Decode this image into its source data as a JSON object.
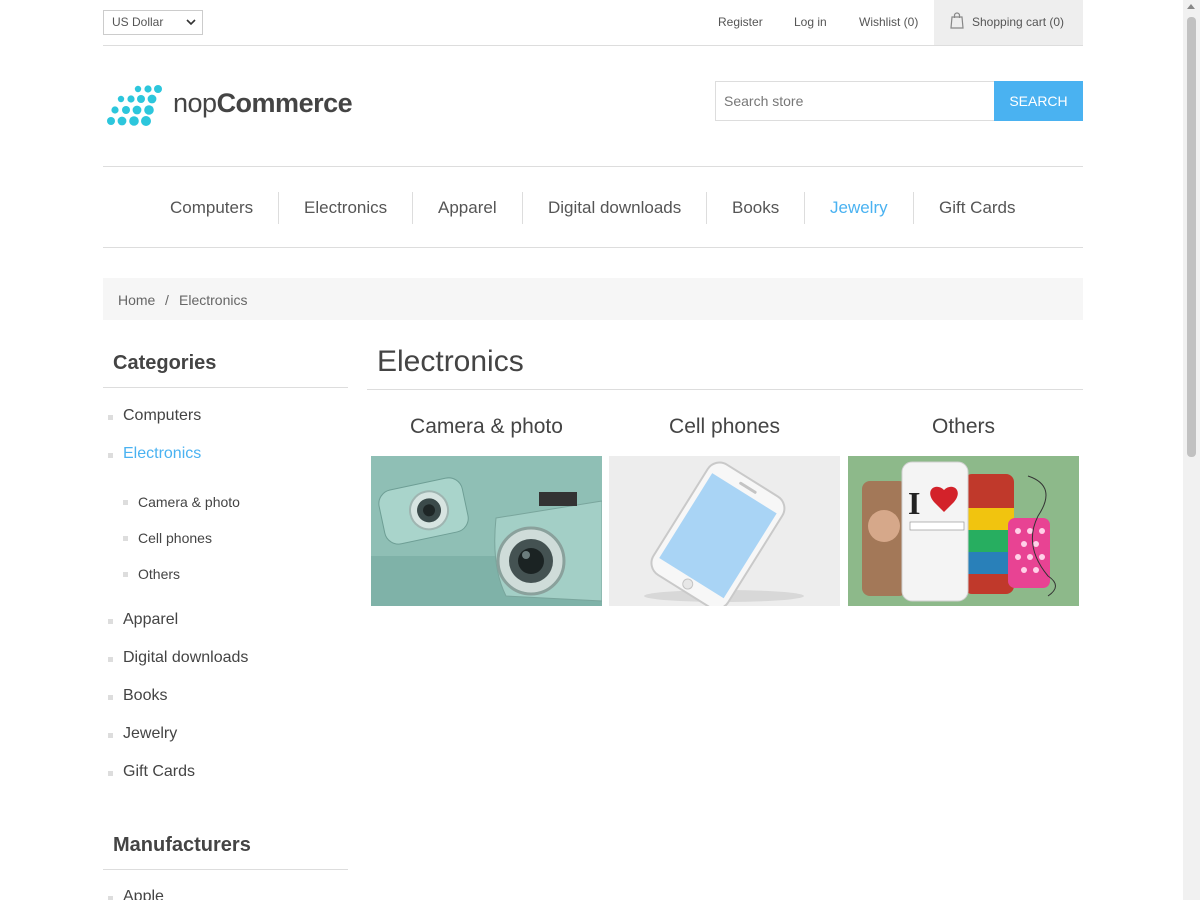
{
  "header": {
    "currency": "US Dollar",
    "links": {
      "register": "Register",
      "login": "Log in",
      "wishlist": "Wishlist (0)",
      "cart": "Shopping cart (0)"
    }
  },
  "logo": {
    "light": "nop",
    "bold": "Commerce"
  },
  "search": {
    "placeholder": "Search store",
    "button": "SEARCH"
  },
  "menu": [
    "Computers",
    "Electronics",
    "Apparel",
    "Digital downloads",
    "Books",
    "Jewelry",
    "Gift Cards"
  ],
  "breadcrumb": {
    "home": "Home",
    "sep": "/",
    "current": "Electronics"
  },
  "sidebar": {
    "categories_title": "Categories",
    "categories": [
      "Computers",
      "Electronics",
      "Apparel",
      "Digital downloads",
      "Books",
      "Jewelry",
      "Gift Cards"
    ],
    "subcategories": [
      "Camera & photo",
      "Cell phones",
      "Others"
    ],
    "manufacturers_title": "Manufacturers",
    "manufacturers": [
      "Apple"
    ]
  },
  "main": {
    "title": "Electronics",
    "subcategories": [
      "Camera & photo",
      "Cell phones",
      "Others"
    ]
  },
  "colors": {
    "accent": "#4ab2f1",
    "logo_dots": "#2cc6dc"
  }
}
